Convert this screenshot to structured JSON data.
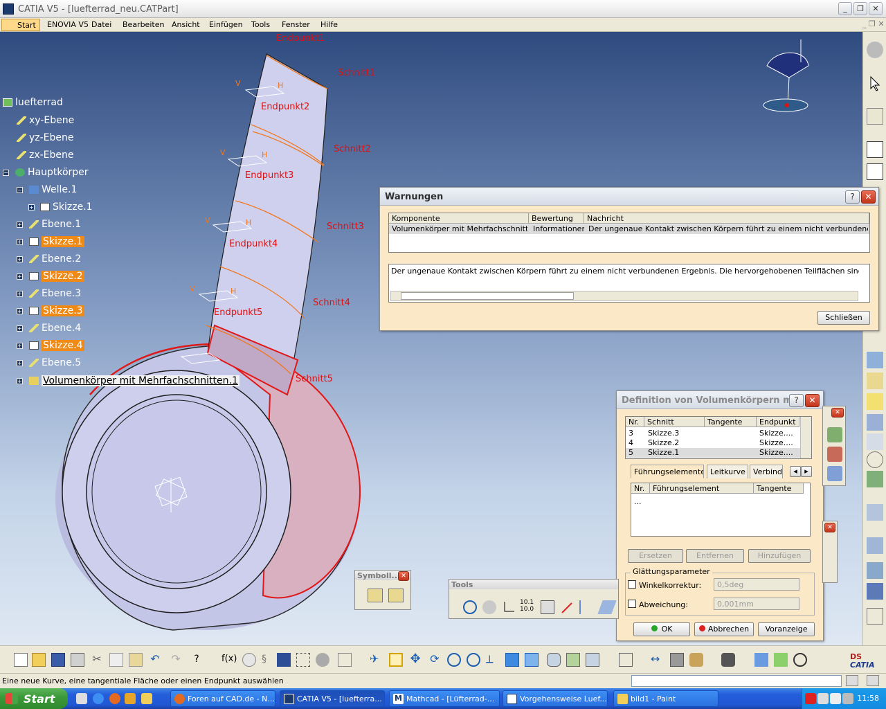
{
  "window": {
    "title": "CATIA V5 - [luefterrad_neu.CATPart]"
  },
  "menu": {
    "start": "Start",
    "items": [
      "ENOVIA V5",
      "Datei",
      "Bearbeiten",
      "Ansicht",
      "Einfügen",
      "Tools",
      "Fenster",
      "Hilfe"
    ]
  },
  "tree": {
    "root": "luefterrad",
    "planes": [
      "xy-Ebene",
      "yz-Ebene",
      "zx-Ebene"
    ],
    "body": "Hauptkörper",
    "welle": "Welle.1",
    "welle_sketch": "Skizze.1",
    "items": [
      {
        "label": "Ebene.1",
        "kind": "plane"
      },
      {
        "label": "Skizze.1",
        "kind": "sketch-selected"
      },
      {
        "label": "Ebene.2",
        "kind": "plane"
      },
      {
        "label": "Skizze.2",
        "kind": "sketch-selected"
      },
      {
        "label": "Ebene.3",
        "kind": "plane"
      },
      {
        "label": "Skizze.3",
        "kind": "sketch-selected"
      },
      {
        "label": "Ebene.4",
        "kind": "plane"
      },
      {
        "label": "Skizze.4",
        "kind": "sketch-selected"
      },
      {
        "label": "Ebene.5",
        "kind": "plane"
      }
    ],
    "active": "Volumenkörper mit Mehrfachschnitten.1"
  },
  "geometry_labels": {
    "endpunkt": [
      "Endpunkt1",
      "Endpunkt2",
      "Endpunkt3",
      "Endpunkt4",
      "Endpunkt5"
    ],
    "schnitt": [
      "Schnitt1",
      "Schnitt2",
      "Schnitt3",
      "Schnitt4",
      "Schnitt5"
    ],
    "h_marker": "H",
    "v_marker": "V"
  },
  "warnings": {
    "title": "Warnungen",
    "help": "?",
    "close": "✕",
    "columns": [
      "Komponente",
      "Bewertung",
      "Nachricht"
    ],
    "row": [
      "Volumenkörper mit Mehrfachschnitten.1",
      "Informationen",
      "Der ungenaue Kontakt zwischen Körpern führt zu einem nicht verbundenen Erge..."
    ],
    "detail": "Der ungenaue Kontakt zwischen Körpern führt zu einem nicht verbundenen Ergebnis. Die hervorgehobenen Teilflächen sind tangential, könn",
    "close_button": "Schließen"
  },
  "loft_dialog": {
    "title": "Definition von Volumenkörpern mit ...",
    "columns": [
      "Nr.",
      "Schnitt",
      "Tangente",
      "Endpunkt"
    ],
    "rows": [
      {
        "nr": "3",
        "schnitt": "Skizze.3",
        "endpunkt": "Skizze...."
      },
      {
        "nr": "4",
        "schnitt": "Skizze.2",
        "endpunkt": "Skizze...."
      },
      {
        "nr": "5",
        "schnitt": "Skizze.1",
        "endpunkt": "Skizze...."
      }
    ],
    "tabs": [
      "Führungselemente",
      "Leitkurve",
      "Verbindu"
    ],
    "guide_columns": [
      "Nr.",
      "Führungselement",
      "Tangente"
    ],
    "guide_placeholder": "...",
    "buttons": [
      "Ersetzen",
      "Entfernen",
      "Hinzufügen"
    ],
    "smoothing_title": "Glättungsparameter",
    "angle_label": "Winkelkorrektur:",
    "angle_value": "0,5deg",
    "deviation_label": "Abweichung:",
    "deviation_value": "0,001mm",
    "ok": "OK",
    "cancel": "Abbrechen",
    "preview": "Voranzeige"
  },
  "toolbars": {
    "symbol": "Symboll...",
    "tools": "Tools",
    "tools_labels": [
      "f(x)",
      "10.1 10.0"
    ]
  },
  "status": {
    "message": "Eine neue Kurve, eine tangentiale Fläche oder einen Endpunkt auswählen"
  },
  "taskbar": {
    "start": "Start",
    "tasks": [
      {
        "label": "Foren auf CAD.de - N...",
        "active": false
      },
      {
        "label": "CATIA V5 - [luefterra...",
        "active": true
      },
      {
        "label": "Mathcad - [Lüfterrad-...",
        "active": false
      },
      {
        "label": "Vorgehensweise Luef...",
        "active": false
      },
      {
        "label": "bild1 - Paint",
        "active": false
      }
    ],
    "clock": "11:58"
  },
  "colors": {
    "selection": "#f08a16",
    "geometry_orange": "#f07820",
    "geometry_red": "#e01818",
    "label_red": "#e01010",
    "part_fill": "#cfd0ee"
  }
}
